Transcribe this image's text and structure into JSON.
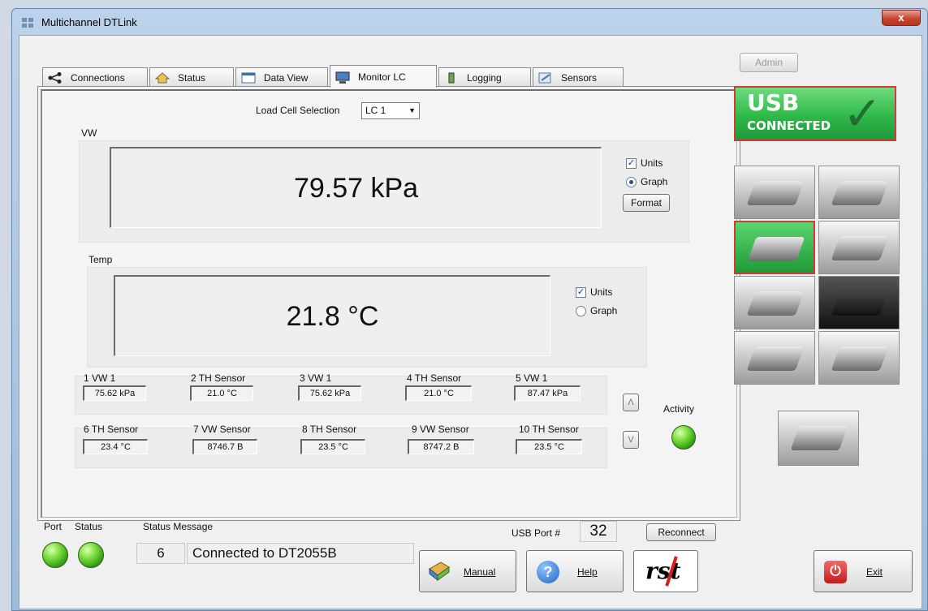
{
  "window": {
    "title": "Multichannel DTLink",
    "close": "x"
  },
  "tabs": [
    {
      "label": "Connections",
      "icon": "share-icon"
    },
    {
      "label": "Status",
      "icon": "home-icon"
    },
    {
      "label": "Data View",
      "icon": "calendar-icon"
    },
    {
      "label": "Monitor LC",
      "icon": "monitor-icon",
      "active": true
    },
    {
      "label": "Logging",
      "icon": "logging-icon"
    },
    {
      "label": "Sensors",
      "icon": "sensors-icon"
    }
  ],
  "monitor": {
    "load_cell_label": "Load Cell Selection",
    "load_cell_value": "LC 1",
    "vw": {
      "group": "VW",
      "reading": "79.57 kPa",
      "units_label": "Units",
      "graph_label": "Graph",
      "format_label": "Format"
    },
    "temp": {
      "group": "Temp",
      "reading": "21.8 °C",
      "units_label": "Units",
      "graph_label": "Graph"
    },
    "sensors_row1": [
      {
        "label": "1 VW 1",
        "value": "75.62 kPa"
      },
      {
        "label": "2 TH Sensor",
        "value": "21.0 °C"
      },
      {
        "label": "3 VW 1",
        "value": "75.62 kPa"
      },
      {
        "label": "4 TH Sensor",
        "value": "21.0 °C"
      },
      {
        "label": "5 VW 1",
        "value": "87.47 kPa"
      }
    ],
    "sensors_row2": [
      {
        "label": "6 TH Sensor",
        "value": "23.4 °C"
      },
      {
        "label": "7 VW Sensor",
        "value": "8746.7 B"
      },
      {
        "label": "8 TH Sensor",
        "value": "23.5 °C"
      },
      {
        "label": "9 VW Sensor",
        "value": "8747.2 B"
      },
      {
        "label": "10 TH Sensor",
        "value": "23.5 °C"
      }
    ],
    "scroll_up": "Λ",
    "scroll_down": "V",
    "activity_label": "Activity"
  },
  "right_panel": {
    "admin_label": "Admin",
    "usb_line1": "USB",
    "usb_line2": "CONNECTED",
    "check": "✓"
  },
  "footer": {
    "port_label": "Port",
    "status_label": "Status",
    "status_message_label": "Status Message",
    "status_code": "6",
    "status_message": "Connected to DT2055B",
    "usb_port_label": "USB Port #",
    "usb_port_value": "32",
    "reconnect_label": "Reconnect",
    "manual_label": "Manual",
    "help_label": "Help",
    "help_glyph": "?",
    "rst_logo": "rst",
    "exit_label": "Exit"
  },
  "colors": {
    "usb_green": "#2fb84a",
    "led_green": "#57c92a",
    "accent_red": "#d23a3a"
  }
}
